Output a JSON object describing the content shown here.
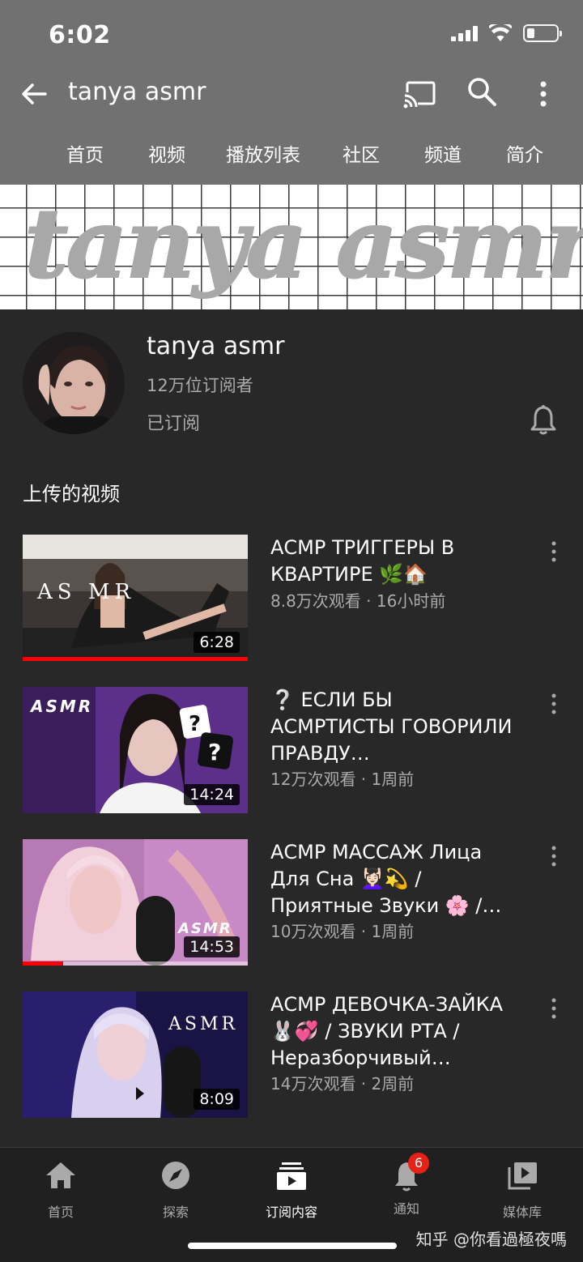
{
  "status_bar": {
    "time": "6:02"
  },
  "app_bar": {
    "title": "tanya asmr"
  },
  "tabs": [
    {
      "label": "首页",
      "active": true
    },
    {
      "label": "视频"
    },
    {
      "label": "播放列表"
    },
    {
      "label": "社区"
    },
    {
      "label": "频道"
    },
    {
      "label": "简介"
    }
  ],
  "banner": {
    "text": "tanya asmr"
  },
  "channel": {
    "name": "tanya asmr",
    "subscribers": "12万位订阅者",
    "subscribed_label": "已订阅"
  },
  "section": {
    "title": "上传的视频"
  },
  "videos": [
    {
      "title": "АСМР ТРИГГЕРЫ В КВАРТИРЕ 🌿🏠",
      "meta": "8.8万次观看 · 16小时前",
      "duration": "6:28",
      "thumb_text": "AS      MR",
      "watched_fraction": 1.0
    },
    {
      "title": "❔ ЕСЛИ БЫ АСМРТИСТЫ ГОВОРИЛИ ПРАВДУ…",
      "meta": "12万次观看 · 1周前",
      "duration": "14:24",
      "thumb_text": "ASMR"
    },
    {
      "title": "АСМР МАССАЖ Лица Для Сна 💆🏻‍♀️💫 / Приятные Звуки 🌸 /…",
      "meta": "10万次观看 · 1周前",
      "duration": "14:53",
      "thumb_text": "ASMR",
      "watched_fraction": 0.18
    },
    {
      "title": "АСМР ДЕВОЧКА-ЗАЙКА 🐰💞 / ЗВУКИ РТА / Неразборчивый…",
      "meta": "14万次观看 · 2周前",
      "duration": "8:09",
      "thumb_text": "ASMR"
    }
  ],
  "bottom_nav": [
    {
      "label": "首页",
      "icon": "home-icon"
    },
    {
      "label": "探索",
      "icon": "compass-icon"
    },
    {
      "label": "订阅内容",
      "icon": "subscriptions-icon",
      "active": true
    },
    {
      "label": "通知",
      "icon": "bell-icon",
      "badge": "6"
    },
    {
      "label": "媒体库",
      "icon": "library-icon"
    }
  ],
  "watermark": "知乎 @你看過極夜嗎"
}
